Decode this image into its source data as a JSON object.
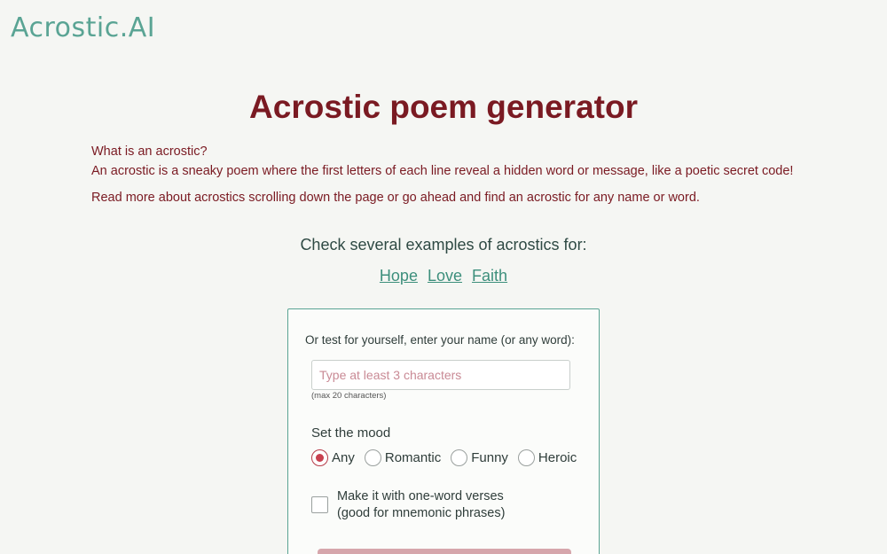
{
  "header": {
    "logo": "Acrostic.AI"
  },
  "page": {
    "title": "Acrostic poem generator",
    "intro": {
      "question": "What is an acrostic?",
      "definition": "An acrostic is a sneaky poem where the first letters of each line reveal a hidden word or message, like a poetic secret code!",
      "read_more": "Read more about acrostics scrolling down the page or go ahead and find an acrostic for any name or word."
    }
  },
  "examples": {
    "label": "Check several examples of acrostics for:",
    "links": [
      "Hope",
      "Love",
      "Faith"
    ]
  },
  "form": {
    "label": "Or test for yourself, enter your name (or any word):",
    "input_value": "",
    "input_placeholder": "Type at least 3 characters",
    "max_note": "(max 20 characters)",
    "mood_label": "Set the mood",
    "moods": [
      {
        "label": "Any",
        "checked": true
      },
      {
        "label": "Romantic",
        "checked": false
      },
      {
        "label": "Funny",
        "checked": false
      },
      {
        "label": "Heroic",
        "checked": false
      }
    ],
    "one_word": {
      "line1": "Make it with one-word verses",
      "line2": "(good for mnemonic phrases)",
      "checked": false
    }
  },
  "colors": {
    "accent": "#5aa494",
    "title": "#7a1a22",
    "link": "#3d8f7c",
    "radio_checked": "#c8404f",
    "button": "#d6a6ac"
  }
}
